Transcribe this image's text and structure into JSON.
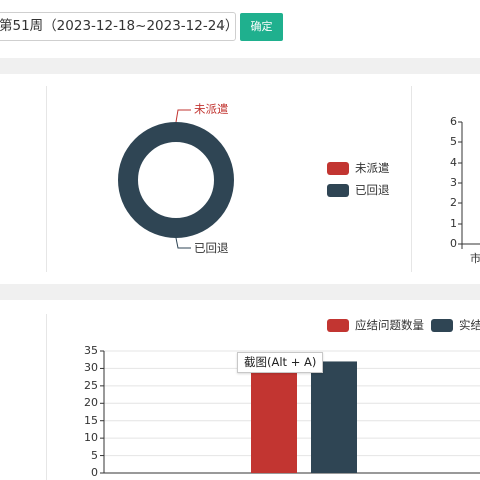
{
  "toolbar": {
    "week_select_value": "第51周（2023-12-18~2023-12-24）",
    "confirm_label": "确定"
  },
  "donut": {
    "legend": [
      {
        "label": "未派遣",
        "color": "#c23531"
      },
      {
        "label": "已回退",
        "color": "#2f4554"
      }
    ],
    "slice_labels": {
      "top": "未派遣",
      "bottom": "已回退"
    }
  },
  "right_chart": {
    "y_ticks": [
      "6",
      "5",
      "4",
      "3",
      "2",
      "1",
      "0"
    ],
    "x_tick_partial": "市"
  },
  "bar_chart_legend": [
    {
      "label": "应结问题数量",
      "color": "#c23531"
    },
    {
      "label": "实结",
      "color": "#2f4554"
    }
  ],
  "tooltip": "截图(Alt + A)",
  "chart_data": [
    {
      "type": "pie",
      "categories": [
        "未派遣",
        "已回退"
      ],
      "values": [
        0,
        1
      ]
    },
    {
      "type": "bar",
      "categories": [
        ""
      ],
      "series": [
        {
          "name": "应结问题数量",
          "values": [
            30
          ]
        },
        {
          "name": "实结",
          "values": [
            32
          ]
        }
      ],
      "ylim": [
        0,
        35
      ],
      "y_ticks": [
        "35",
        "30",
        "25",
        "20",
        "15",
        "10",
        "5",
        "0"
      ]
    }
  ]
}
